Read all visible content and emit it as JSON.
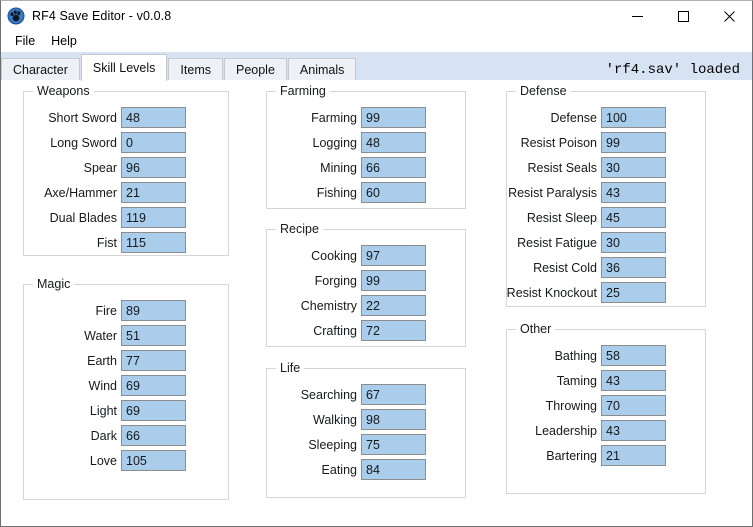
{
  "window": {
    "title": "RF4 Save Editor - v0.0.8",
    "icon": "paw-app-icon",
    "minimize_label": "Minimize",
    "maximize_label": "Maximize",
    "close_label": "Close"
  },
  "menubar": {
    "items": [
      {
        "label": "File"
      },
      {
        "label": "Help"
      }
    ]
  },
  "tabs": {
    "items": [
      {
        "label": "Character",
        "active": false
      },
      {
        "label": "Skill Levels",
        "active": true
      },
      {
        "label": "Items",
        "active": false
      },
      {
        "label": "People",
        "active": false
      },
      {
        "label": "Animals",
        "active": false
      }
    ],
    "status": "'rf4.sav' loaded"
  },
  "colors": {
    "field_fill": "#a9cdeb",
    "field_border": "#8d8d8d",
    "tabstrip_bg": "#d7e3f2",
    "group_border": "#d5d5d5",
    "window_border": "#6e6e6e",
    "text": "#16191d"
  },
  "groups": [
    {
      "id": "weapons",
      "title": "Weapons",
      "fields": [
        {
          "label": "Short Sword",
          "value": "48"
        },
        {
          "label": "Long Sword",
          "value": "0"
        },
        {
          "label": "Spear",
          "value": "96"
        },
        {
          "label": "Axe/Hammer",
          "value": "21"
        },
        {
          "label": "Dual Blades",
          "value": "119"
        },
        {
          "label": "Fist",
          "value": "115"
        }
      ]
    },
    {
      "id": "magic",
      "title": "Magic",
      "fields": [
        {
          "label": "Fire",
          "value": "89"
        },
        {
          "label": "Water",
          "value": "51"
        },
        {
          "label": "Earth",
          "value": "77"
        },
        {
          "label": "Wind",
          "value": "69"
        },
        {
          "label": "Light",
          "value": "69"
        },
        {
          "label": "Dark",
          "value": "66"
        },
        {
          "label": "Love",
          "value": "105"
        }
      ]
    },
    {
      "id": "farming",
      "title": "Farming",
      "fields": [
        {
          "label": "Farming",
          "value": "99"
        },
        {
          "label": "Logging",
          "value": "48"
        },
        {
          "label": "Mining",
          "value": "66"
        },
        {
          "label": "Fishing",
          "value": "60"
        }
      ]
    },
    {
      "id": "recipe",
      "title": "Recipe",
      "fields": [
        {
          "label": "Cooking",
          "value": "97"
        },
        {
          "label": "Forging",
          "value": "99"
        },
        {
          "label": "Chemistry",
          "value": "22"
        },
        {
          "label": "Crafting",
          "value": "72"
        }
      ]
    },
    {
      "id": "life",
      "title": "Life",
      "fields": [
        {
          "label": "Searching",
          "value": "67"
        },
        {
          "label": "Walking",
          "value": "98"
        },
        {
          "label": "Sleeping",
          "value": "75"
        },
        {
          "label": "Eating",
          "value": "84"
        }
      ]
    },
    {
      "id": "defense",
      "title": "Defense",
      "fields": [
        {
          "label": "Defense",
          "value": "100"
        },
        {
          "label": "Resist Poison",
          "value": "99"
        },
        {
          "label": "Resist Seals",
          "value": "30"
        },
        {
          "label": "Resist Paralysis",
          "value": "43"
        },
        {
          "label": "Resist Sleep",
          "value": "45"
        },
        {
          "label": "Resist Fatigue",
          "value": "30"
        },
        {
          "label": "Resist Cold",
          "value": "36"
        },
        {
          "label": "Resist Knockout",
          "value": "25"
        }
      ]
    },
    {
      "id": "other",
      "title": "Other",
      "fields": [
        {
          "label": "Bathing",
          "value": "58"
        },
        {
          "label": "Taming",
          "value": "43"
        },
        {
          "label": "Throwing",
          "value": "70"
        },
        {
          "label": "Leadership",
          "value": "43"
        },
        {
          "label": "Bartering",
          "value": "21"
        }
      ]
    }
  ]
}
